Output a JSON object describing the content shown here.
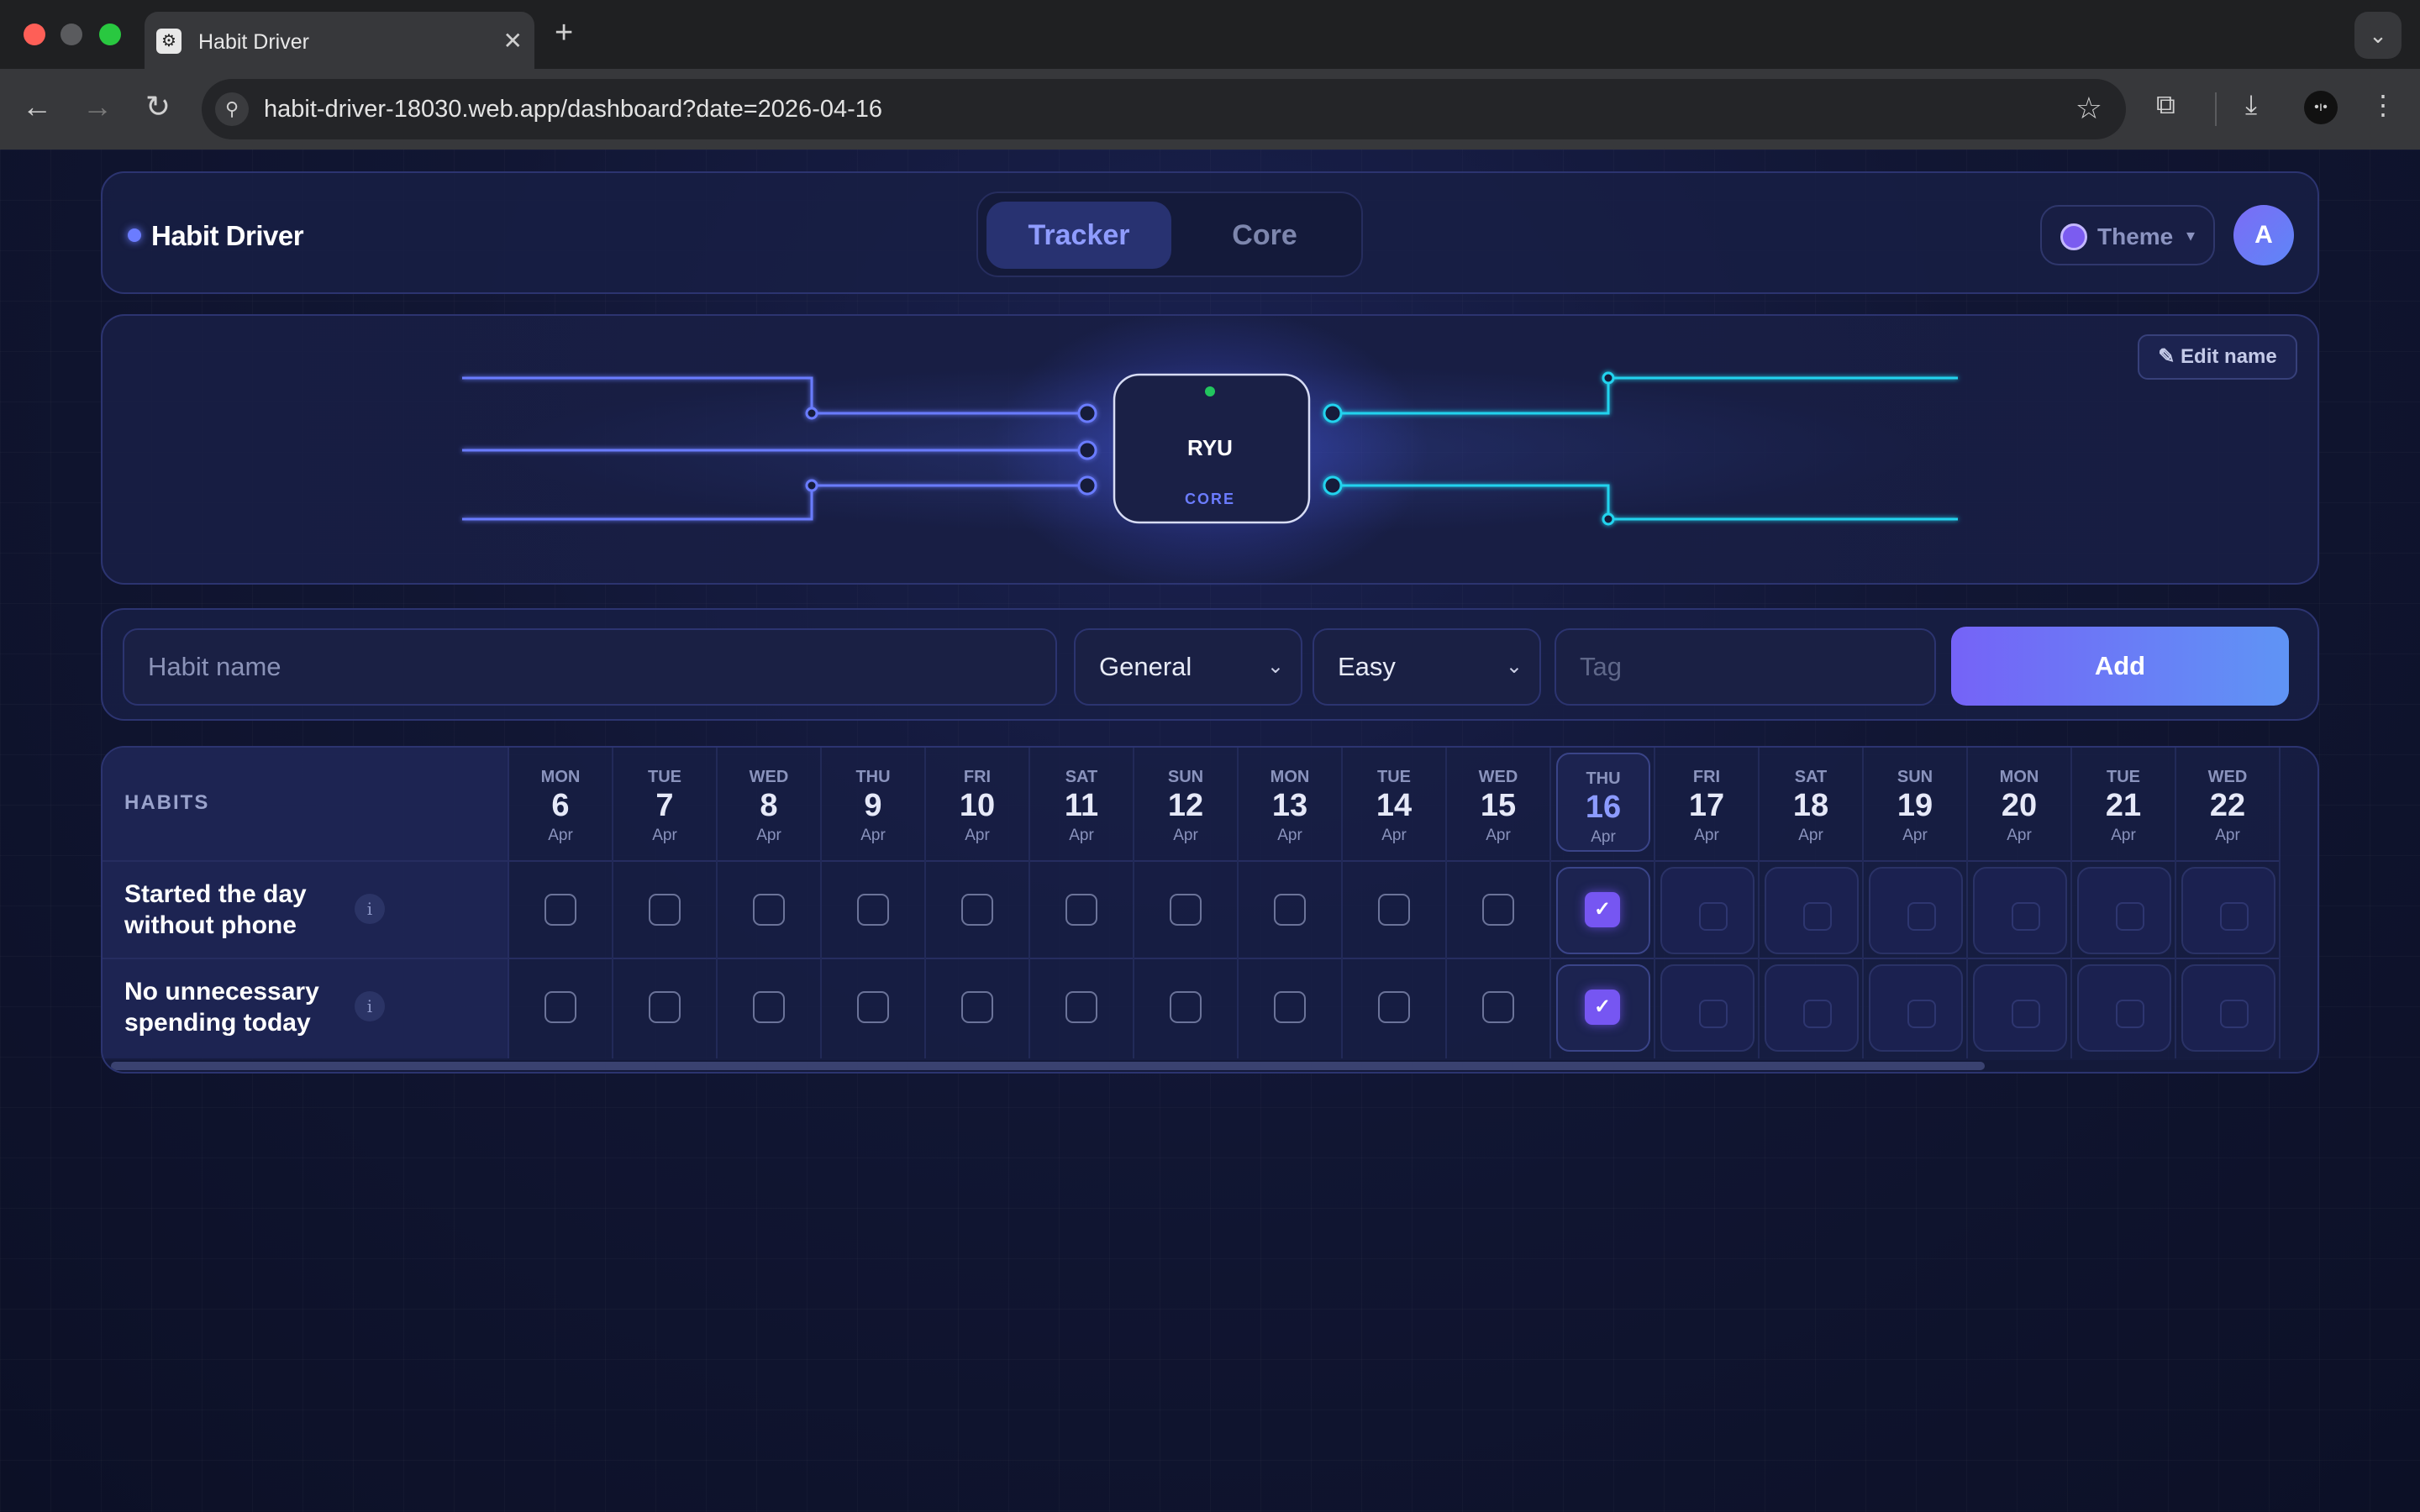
{
  "browser": {
    "tab_title": "Habit Driver",
    "url": "habit-driver-18030.web.app/dashboard?date=2026-04-16"
  },
  "header": {
    "brand": "Habit Driver",
    "tabs": [
      {
        "label": "Tracker",
        "active": true
      },
      {
        "label": "Core",
        "active": false
      }
    ],
    "theme_label": "Theme",
    "avatar_letter": "A"
  },
  "core": {
    "name": "RYU",
    "subtitle": "CORE",
    "edit_label": "Edit name",
    "status_color": "#22c55e"
  },
  "form": {
    "name_placeholder": "Habit name",
    "category": "General",
    "difficulty": "Easy",
    "tag_placeholder": "Tag",
    "add_label": "Add"
  },
  "table": {
    "habits_header": "HABITS",
    "days": [
      {
        "dow": "MON",
        "num": "6",
        "mon": "Apr"
      },
      {
        "dow": "TUE",
        "num": "7",
        "mon": "Apr"
      },
      {
        "dow": "WED",
        "num": "8",
        "mon": "Apr"
      },
      {
        "dow": "THU",
        "num": "9",
        "mon": "Apr"
      },
      {
        "dow": "FRI",
        "num": "10",
        "mon": "Apr"
      },
      {
        "dow": "SAT",
        "num": "11",
        "mon": "Apr"
      },
      {
        "dow": "SUN",
        "num": "12",
        "mon": "Apr"
      },
      {
        "dow": "MON",
        "num": "13",
        "mon": "Apr"
      },
      {
        "dow": "TUE",
        "num": "14",
        "mon": "Apr"
      },
      {
        "dow": "WED",
        "num": "15",
        "mon": "Apr"
      },
      {
        "dow": "THU",
        "num": "16",
        "mon": "Apr",
        "today": true
      },
      {
        "dow": "FRI",
        "num": "17",
        "mon": "Apr",
        "future": true
      },
      {
        "dow": "SAT",
        "num": "18",
        "mon": "Apr",
        "future": true
      },
      {
        "dow": "SUN",
        "num": "19",
        "mon": "Apr",
        "future": true
      },
      {
        "dow": "MON",
        "num": "20",
        "mon": "Apr",
        "future": true
      },
      {
        "dow": "TUE",
        "num": "21",
        "mon": "Apr",
        "future": true
      },
      {
        "dow": "WED",
        "num": "22",
        "mon": "Apr",
        "future": true
      }
    ],
    "habits": [
      {
        "name": "Started the day without phone",
        "checked_days": [
          "16"
        ]
      },
      {
        "name": "No unnecessary spending today",
        "checked_days": [
          "16"
        ]
      }
    ]
  },
  "colors": {
    "accent": "#7656f2",
    "left_wire": "#6b7cff",
    "right_wire": "#22d3ee"
  }
}
